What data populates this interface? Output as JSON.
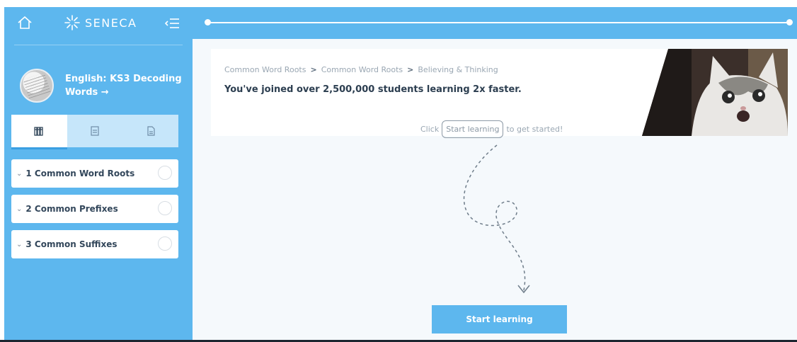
{
  "brand": {
    "name": "SENECA"
  },
  "course": {
    "title": "English: KS3 Decoding Words →"
  },
  "tabs": [
    {
      "icon": "books-icon"
    },
    {
      "icon": "notes-icon"
    },
    {
      "icon": "document-icon"
    }
  ],
  "topics": [
    {
      "number": "1",
      "label": "1 Common Word Roots"
    },
    {
      "number": "2",
      "label": "2 Common Prefixes"
    },
    {
      "number": "3",
      "label": "3 Common Suffixes"
    }
  ],
  "breadcrumb": {
    "items": [
      "Common Word Roots",
      "Common Word Roots",
      "Believing & Thinking"
    ],
    "separator": ">"
  },
  "main": {
    "joined_text": "You've joined over 2,500,000 students learning 2x faster.",
    "hint_prefix": "Click",
    "hint_pill": "Start learning",
    "hint_suffix": "to get started!",
    "start_button": "Start learning"
  },
  "colors": {
    "brand_blue": "#5db7ee",
    "tab_bg": "#c6e6fa",
    "tab_active_underline": "#3a9fe2",
    "main_bg": "#f5f9fc"
  }
}
